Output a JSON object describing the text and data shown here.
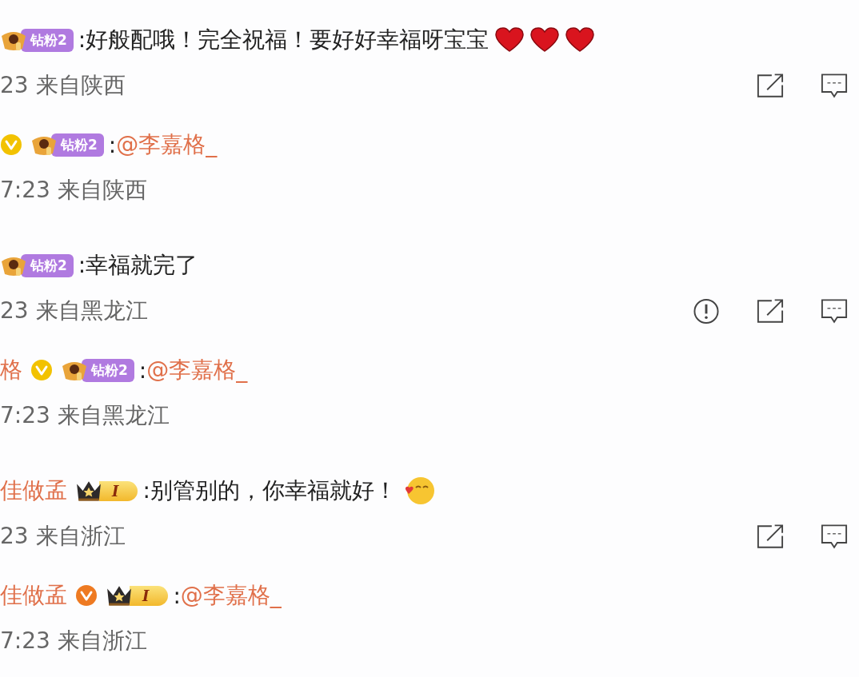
{
  "comments": [
    {
      "kind": "main",
      "badge": {
        "kind": "fan",
        "label": "钻粉2"
      },
      "content": ":好般配哦！完全祝福！要好好幸福呀宝宝",
      "emojis": [
        {
          "kind": "heart"
        },
        {
          "kind": "heart"
        },
        {
          "kind": "heart"
        }
      ],
      "meta": "23 来自陕西",
      "actions": [
        {
          "kind": "share"
        },
        {
          "kind": "comment"
        }
      ]
    },
    {
      "kind": "reply",
      "verified": {
        "color": "#f2c200"
      },
      "badge": {
        "kind": "fan",
        "label": "钻粉2"
      },
      "content": ":",
      "mention": "@李嘉格_",
      "meta": "7:23 来自陕西"
    },
    {
      "kind": "main",
      "badge": {
        "kind": "fan",
        "label": "钻粉2"
      },
      "content": ":幸福就完了",
      "meta": "23 来自黑龙江",
      "actions": [
        {
          "kind": "report"
        },
        {
          "kind": "share"
        },
        {
          "kind": "comment"
        }
      ]
    },
    {
      "kind": "reply",
      "name": "格",
      "verified": {
        "color": "#f2c200"
      },
      "badge": {
        "kind": "fan",
        "label": "钻粉2"
      },
      "content": ":",
      "mention": "@李嘉格_",
      "meta": "7:23 来自黑龙江"
    },
    {
      "kind": "main",
      "name": "佳做孟",
      "badge": {
        "kind": "crown",
        "label": "I"
      },
      "content": ":别管别的，你幸福就好！",
      "emojis": [
        {
          "kind": "kiss"
        }
      ],
      "meta": "23 来自浙江",
      "actions": [
        {
          "kind": "share"
        },
        {
          "kind": "comment"
        }
      ]
    },
    {
      "kind": "reply",
      "name": "佳做孟",
      "verified": {
        "color": "#ee7a22"
      },
      "badge": {
        "kind": "crown",
        "label": "I"
      },
      "content": ":",
      "mention": "@李嘉格_",
      "meta": "7:23 来自浙江"
    }
  ]
}
